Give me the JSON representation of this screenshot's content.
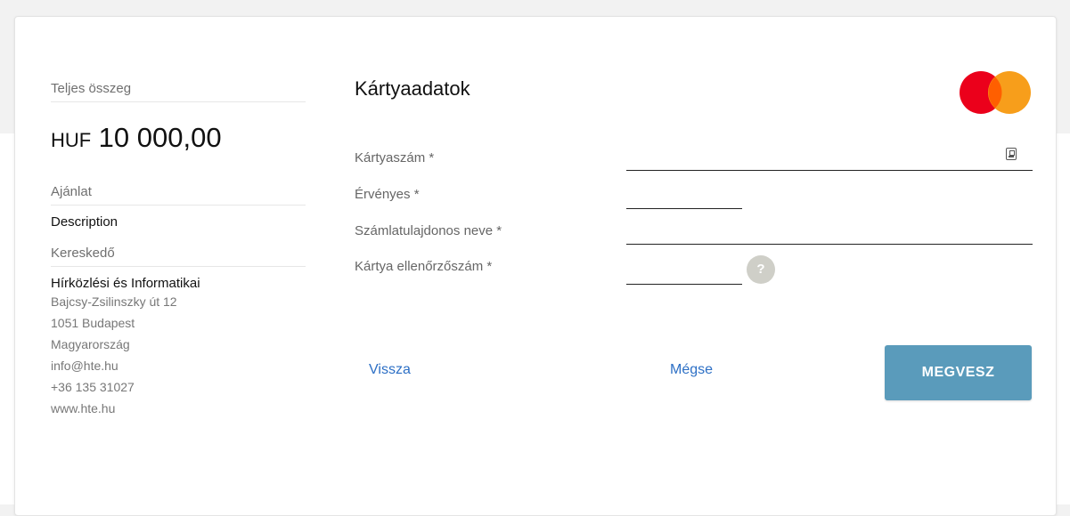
{
  "summary": {
    "total_label": "Teljes összeg",
    "currency": "HUF",
    "amount": "10 000,00",
    "offer_label": "Ajánlat",
    "offer_value": "Description",
    "merchant_label": "Kereskedő",
    "merchant_name": "Hírközlési és Informatikai",
    "merchant_address": [
      "Bajcsy-Zsilinszky út 12",
      "1051 Budapest",
      "Magyarország",
      "info@hte.hu",
      "+36 135 31027",
      "www.hte.hu"
    ]
  },
  "form": {
    "title": "Kártyaadatok",
    "card_number_label": "Kártyaszám *",
    "card_number_value": "",
    "expiry_label": "Érvényes *",
    "expiry_value": "",
    "holder_label": "Számlatulajdonos neve *",
    "holder_value": "",
    "cvc_label": "Kártya ellenőrzőszám *",
    "cvc_value": "",
    "help_symbol": "?"
  },
  "actions": {
    "back_label": "Vissza",
    "cancel_label": "Mégse",
    "buy_label": "MEGVESZ"
  },
  "icons": {
    "card_brand": "mastercard-logo-icon",
    "scan": "card-scan-icon",
    "help": "question-mark-icon"
  },
  "colors": {
    "link": "#2c6fc5",
    "button": "#5a9bbb",
    "mastercard_red": "#eb001b",
    "mastercard_orange": "#f79e1b",
    "mastercard_overlap": "#ff5f00"
  }
}
